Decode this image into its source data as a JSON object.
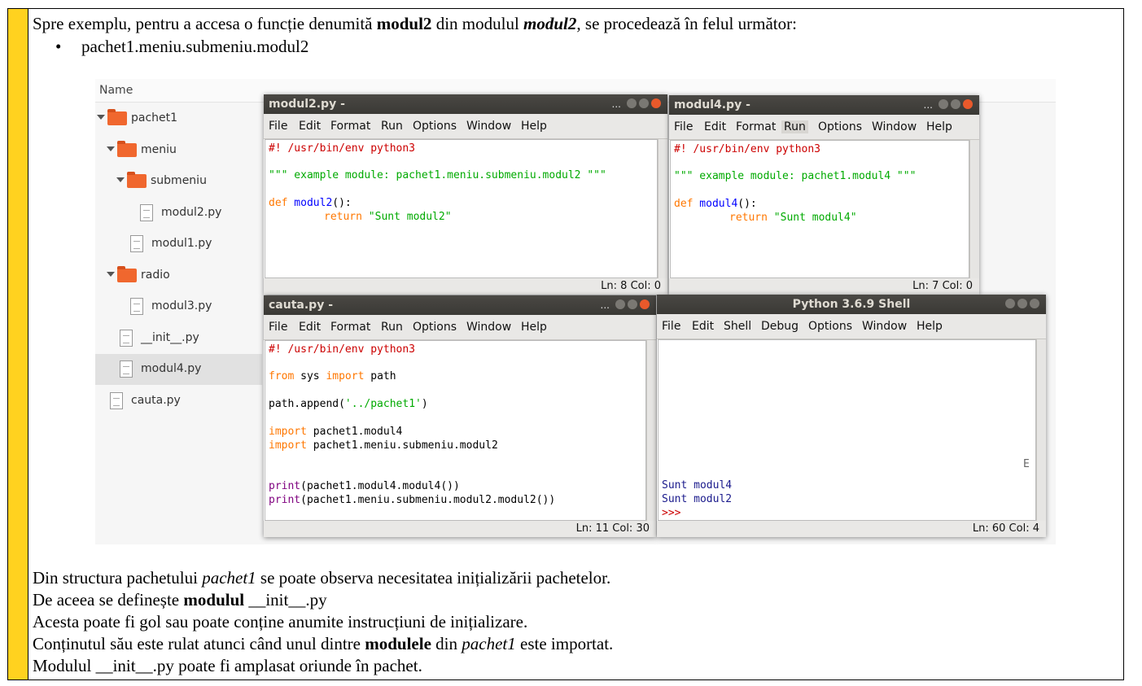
{
  "doc": {
    "intro_pre": "Spre exemplu, pentru a accesa o funcție denumită ",
    "intro_b1": "modul2",
    "intro_mid": " din modulul ",
    "intro_bi": "modul2",
    "intro_post": ", se procedează în felul următor:",
    "bullet_mark": "•",
    "bullet": "pachet1.meniu.submeniu.modul2",
    "p1_pre": "Din structura pachetului ",
    "p1_i": "pachet1",
    "p1_post": " se poate observa necesitatea inițializării pachetelor.",
    "p2_pre": "De aceea se definește ",
    "p2_b": "modulul",
    "p2_post": " __init__.py",
    "p3": "Acesta poate fi gol sau poate conține anumite instrucțiuni de inițializare.",
    "p4_pre": "Conținutul său este rulat atunci când unul dintre ",
    "p4_b": "modulele",
    "p4_mid": " din ",
    "p4_i": "pachet1",
    "p4_post": " este importat.",
    "p5": "Modulul __init__.py poate fi amplasat oriunde în pachet."
  },
  "file_manager": {
    "header": "Name",
    "items": [
      "pachet1",
      "meniu",
      "submeniu",
      "modul2.py",
      "modul1.py",
      "radio",
      "modul3.py",
      "__init__.py",
      "modul4.py",
      "cauta.py"
    ]
  },
  "menu_idle": [
    "File",
    "Edit",
    "Format",
    "Run",
    "Options",
    "Window",
    "Help"
  ],
  "menu_shell": [
    "File",
    "Edit",
    "Shell",
    "Debug",
    "Options",
    "Window",
    "Help"
  ],
  "win_modul2": {
    "title": "modul2.py -",
    "dots": "...",
    "code": [
      "#! /usr/bin/env python3",
      "\"\"\" example module: pachet1.meniu.submeniu.modul2 \"\"\"",
      "def",
      " modul2",
      "():",
      "return",
      " \"Sunt modul2\""
    ],
    "status": "Ln: 8  Col: 0"
  },
  "win_modul4": {
    "title": "modul4.py -",
    "dots": "...",
    "code": [
      "#! /usr/bin/env python3",
      "\"\"\" example module: pachet1.modul4 \"\"\"",
      "def",
      " modul4",
      "():",
      "return",
      " \"Sunt modul4\""
    ],
    "status": "Ln: 7  Col: 0"
  },
  "win_cauta": {
    "title": "cauta.py -",
    "dots": "...",
    "code": [
      "#! /usr/bin/env python3",
      "from",
      " sys ",
      "import",
      " path",
      "path.append(",
      "'../pachet1'",
      ")",
      "import",
      " pachet1.modul4",
      " pachet1.meniu.submeniu.modul2",
      "print",
      "(pachet1.modul4.modul4())",
      "(pachet1.meniu.submeniu.modul2.modul2())"
    ],
    "status": "Ln: 11  Col: 30"
  },
  "win_shell": {
    "title": "Python 3.6.9 Shell",
    "output": [
      "Sunt modul4",
      "Sunt modul2",
      ">>>"
    ],
    "stray": "E",
    "status": "Ln: 60  Col: 4"
  }
}
